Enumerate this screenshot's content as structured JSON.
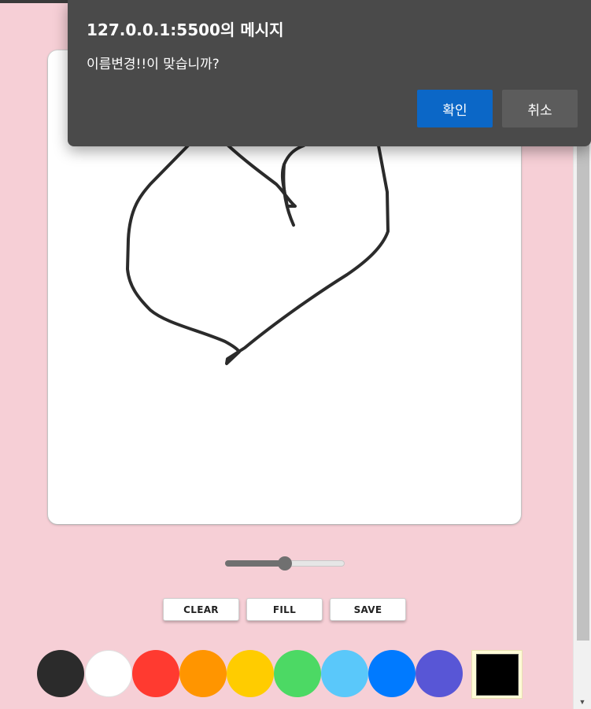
{
  "dialog": {
    "title": "127.0.0.1:5500의 메시지",
    "message": "이름변경!!이 맞습니까?",
    "ok_label": "확인",
    "cancel_label": "취소"
  },
  "toolbar": {
    "clear_label": "CLEAR",
    "fill_label": "FILL",
    "save_label": "SAVE"
  },
  "line_width_slider": {
    "value_fraction": 0.5
  },
  "palette": [
    {
      "name": "black",
      "color": "#2b2b2b"
    },
    {
      "name": "white",
      "color": "#ffffff"
    },
    {
      "name": "red",
      "color": "#ff3a30"
    },
    {
      "name": "orange",
      "color": "#ff9500"
    },
    {
      "name": "yellow",
      "color": "#ffcc00"
    },
    {
      "name": "green",
      "color": "#4cd964"
    },
    {
      "name": "sky-blue",
      "color": "#5ac8fa"
    },
    {
      "name": "blue",
      "color": "#007aff"
    },
    {
      "name": "purple",
      "color": "#5856d6"
    }
  ],
  "color_picker": {
    "value": "#000000"
  },
  "stroke_color": "#2b2b2b"
}
